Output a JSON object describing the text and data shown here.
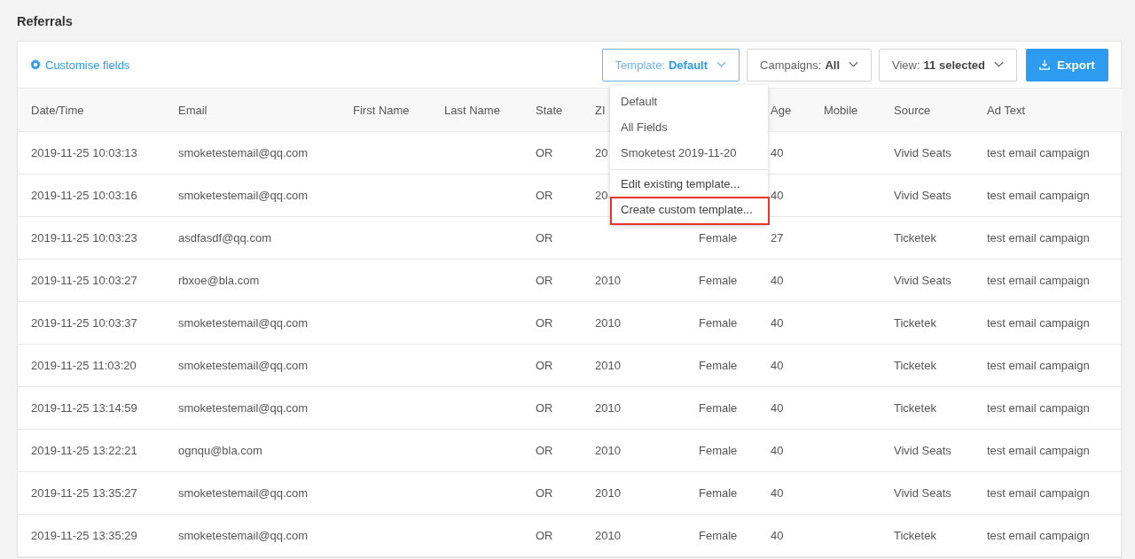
{
  "page": {
    "title": "Referrals"
  },
  "toolbar": {
    "customise_link": "Customise fields",
    "filters": [
      {
        "label": "Template:",
        "value": "Default",
        "open": true
      },
      {
        "label": "Campaigns:",
        "value": "All",
        "open": false
      },
      {
        "label": "View:",
        "value": "11 selected",
        "open": false
      }
    ],
    "export_button": "Export"
  },
  "template_menu": {
    "items": [
      {
        "label": "Default",
        "kind": "option",
        "highlighted": false
      },
      {
        "label": "All Fields",
        "kind": "option",
        "highlighted": false
      },
      {
        "label": "Smoketest 2019-11-20",
        "kind": "option",
        "highlighted": false
      },
      {
        "label": "Edit existing template...",
        "kind": "action",
        "highlighted": false
      },
      {
        "label": "Create custom template...",
        "kind": "action",
        "highlighted": true
      }
    ]
  },
  "table": {
    "columns": [
      "Date/Time",
      "Email",
      "First Name",
      "Last Name",
      "State",
      "ZI",
      null,
      "Age",
      "Mobile",
      "Source",
      "Ad Text"
    ],
    "rows": [
      [
        "2019-11-25 10:03:13",
        "smoketestemail@qq.com",
        null,
        null,
        "OR",
        "20",
        null,
        "40",
        null,
        "Vivid Seats",
        "test email campaign"
      ],
      [
        "2019-11-25 10:03:16",
        "smoketestemail@qq.com",
        null,
        null,
        "OR",
        "20",
        null,
        "40",
        null,
        "Vivid Seats",
        "test email campaign"
      ],
      [
        "2019-11-25 10:03:23",
        "asdfasdf@qq.com",
        null,
        null,
        "OR",
        null,
        "Female",
        "27",
        null,
        "Ticketek",
        "test email campaign"
      ],
      [
        "2019-11-25 10:03:27",
        "rbxoe@bla.com",
        null,
        null,
        "OR",
        "2010",
        "Female",
        "40",
        null,
        "Vivid Seats",
        "test email campaign"
      ],
      [
        "2019-11-25 10:03:37",
        "smoketestemail@qq.com",
        null,
        null,
        "OR",
        "2010",
        "Female",
        "40",
        null,
        "Ticketek",
        "test email campaign"
      ],
      [
        "2019-11-25 11:03:20",
        "smoketestemail@qq.com",
        null,
        null,
        "OR",
        "2010",
        "Female",
        "40",
        null,
        "Ticketek",
        "test email campaign"
      ],
      [
        "2019-11-25 13:14:59",
        "smoketestemail@qq.com",
        null,
        null,
        "OR",
        "2010",
        "Female",
        "40",
        null,
        "Ticketek",
        "test email campaign"
      ],
      [
        "2019-11-25 13:22:21",
        "ognqu@bla.com",
        null,
        null,
        "OR",
        "2010",
        "Female",
        "40",
        null,
        "Vivid Seats",
        "test email campaign"
      ],
      [
        "2019-11-25 13:35:27",
        "smoketestemail@qq.com",
        null,
        null,
        "OR",
        "2010",
        "Female",
        "40",
        null,
        "Vivid Seats",
        "test email campaign"
      ],
      [
        "2019-11-25 13:35:29",
        "smoketestemail@qq.com",
        null,
        null,
        "OR",
        "2010",
        "Female",
        "40",
        null,
        "Ticketek",
        "test email campaign"
      ]
    ]
  }
}
